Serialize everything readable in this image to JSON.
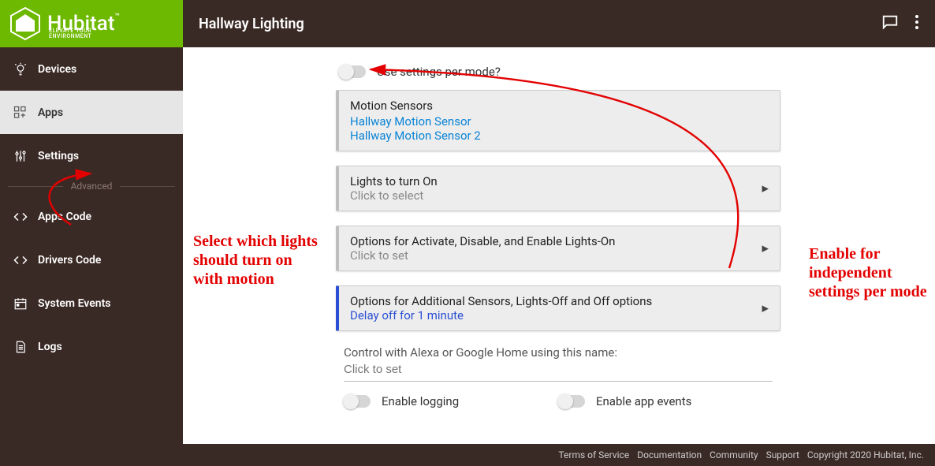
{
  "header": {
    "brand": "Hubitat",
    "tagline": "ELEVATE YOUR ENVIRONMENT",
    "title": "Hallway Lighting"
  },
  "sidebar": {
    "items": [
      {
        "label": "Devices",
        "icon": "bulb"
      },
      {
        "label": "Apps",
        "icon": "apps",
        "active": true
      },
      {
        "label": "Settings",
        "icon": "sliders"
      }
    ],
    "divider": "Advanced",
    "advanced": [
      {
        "label": "Apps Code",
        "icon": "code"
      },
      {
        "label": "Drivers Code",
        "icon": "code"
      },
      {
        "label": "System Events",
        "icon": "calendar"
      },
      {
        "label": "Logs",
        "icon": "doc"
      }
    ]
  },
  "main": {
    "perModeLabel": "Use settings per mode?",
    "sensorsCard": {
      "title": "Motion Sensors",
      "items": [
        "Hallway Motion Sensor",
        "Hallway Motion Sensor 2"
      ]
    },
    "lightsCard": {
      "title": "Lights to turn On",
      "sub": "Click to select"
    },
    "optionsCard": {
      "title": "Options for Activate, Disable, and Enable Lights-On",
      "sub": "Click to set"
    },
    "additionalCard": {
      "title": "Options for Additional Sensors, Lights-Off and Off options",
      "value": "Delay off for 1 minute"
    },
    "voice": {
      "label": "Control with Alexa or Google Home using this name:",
      "placeholder": "Click to set"
    },
    "logging": "Enable logging",
    "events": "Enable app events"
  },
  "footer": {
    "links": [
      "Terms of Service",
      "Documentation",
      "Community",
      "Support"
    ],
    "copyright": "Copyright 2020 Hubitat, Inc."
  },
  "annotations": {
    "left": "Select which lights should turn on with motion",
    "right": "Enable for independent settings per mode"
  }
}
